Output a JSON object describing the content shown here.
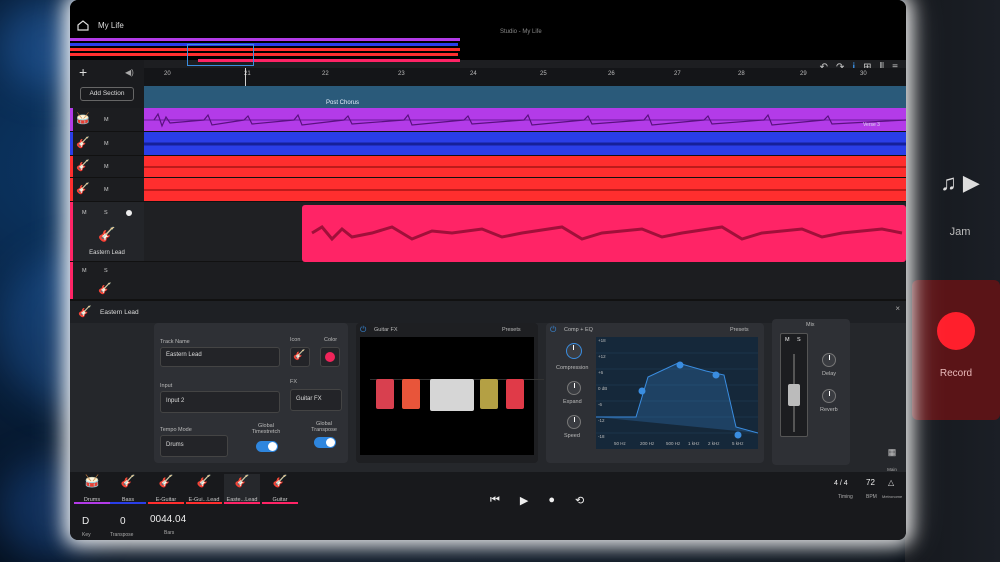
{
  "app": {
    "title": "My Life",
    "window_title": "Studio - My Life"
  },
  "toolbar": {
    "add_section": "Add Section",
    "icons": [
      "undo-icon",
      "redo-icon",
      "info-icon",
      "grid-icon",
      "mixer-icon",
      "menu-icon"
    ]
  },
  "ruler": {
    "bars": [
      "20",
      "21",
      "22",
      "23",
      "24",
      "25",
      "26",
      "27",
      "28",
      "29",
      "30"
    ]
  },
  "sections": [
    {
      "label": "Post Chorus"
    },
    {
      "label": "Verse 3"
    }
  ],
  "tracks": [
    {
      "name": "",
      "icon": "drum-kit-icon",
      "color": "#b33be8",
      "mute": "M"
    },
    {
      "name": "",
      "icon": "guitar-icon",
      "color": "#2a3ee8",
      "mute": "M"
    },
    {
      "name": "",
      "icon": "guitar-icon",
      "color": "#ff2e2e",
      "mute": "M"
    },
    {
      "name": "",
      "icon": "guitar-icon",
      "color": "#ff2e2e",
      "mute": "M"
    },
    {
      "name": "Eastern Lead",
      "icon": "guitar-icon",
      "color": "#ff2466",
      "mute": "M",
      "solo": "S"
    },
    {
      "name": "",
      "icon": "guitar-icon",
      "color": "#ff2466",
      "mute": "M",
      "solo": "S"
    }
  ],
  "detail": {
    "track_name": "Eastern Lead",
    "labels": {
      "track_name": "Track Name",
      "icon": "Icon",
      "color": "Color",
      "input": "Input",
      "fx": "FX",
      "tempo_mode": "Tempo Mode",
      "global_timestretch": "Global Timestretch",
      "global_transpose": "Global Transpose"
    },
    "values": {
      "track_name": "Eastern Lead",
      "input": "Input 2",
      "fx": "Guitar FX",
      "tempo_mode": "Drums"
    },
    "guitar_fx": {
      "title": "Guitar FX",
      "presets": "Presets"
    },
    "comp_eq": {
      "title": "Comp + EQ",
      "presets": "Presets",
      "knobs": [
        "Compression",
        "Expand",
        "Speed"
      ],
      "db_labels": [
        "+18",
        "+12",
        "+6",
        "0 dB",
        "-6",
        "-12",
        "-18"
      ],
      "freq_labels": [
        "50 Hz",
        "200 Hz",
        "500 Hz",
        "1 kHz",
        "2 kHz",
        "5 kHz"
      ]
    },
    "mix": {
      "title": "Mix",
      "m": "M",
      "s": "S",
      "knobs": [
        "Delay",
        "Reverb"
      ],
      "main": "Main"
    }
  },
  "bottom_tabs": [
    {
      "label": "Drums",
      "icon": "drum-kit-icon",
      "color": "#b33be8"
    },
    {
      "label": "Bass",
      "icon": "guitar-icon",
      "color": "#2a3ee8"
    },
    {
      "label": "E-Guitar",
      "icon": "guitar-icon",
      "color": "#ff2e2e"
    },
    {
      "label": "E-Gui...Lead",
      "icon": "guitar-icon",
      "color": "#ff2e2e"
    },
    {
      "label": "Easte...Lead",
      "icon": "guitar-icon",
      "color": "#ff2466"
    },
    {
      "label": "Guitar",
      "icon": "guitar-icon",
      "color": "#ff2466"
    }
  ],
  "status": {
    "key": "D",
    "key_label": "Key",
    "transpose": "0",
    "transpose_label": "Transpose",
    "bars": "0044.04",
    "bars_label": "Bars",
    "timing": "4 / 4",
    "timing_label": "Timing",
    "bpm": "72",
    "bpm_label": "BPM",
    "metronome_label": "Metronome"
  },
  "background": {
    "jam": "Jam",
    "record": "Record"
  }
}
